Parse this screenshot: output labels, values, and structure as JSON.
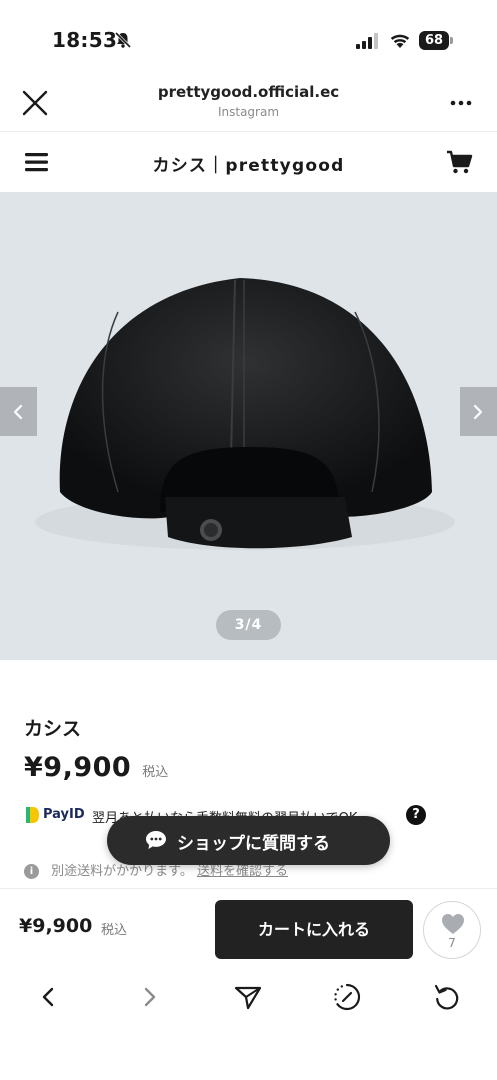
{
  "status_bar": {
    "time": "18:53",
    "battery": "68",
    "icons": [
      "bell-slash-icon",
      "signal-icon",
      "wifi-icon",
      "battery-icon"
    ]
  },
  "browser_header": {
    "domain": "prettygood.official.ec",
    "source": "Instagram",
    "icons": [
      "close-icon",
      "more-icon"
    ]
  },
  "shop_nav": {
    "title": "カシス｜prettygood",
    "icons": [
      "menu-icon",
      "cart-icon"
    ]
  },
  "carousel": {
    "page_indicator": "3/4",
    "current": 3,
    "total": 4,
    "icons": [
      "chevron-left-icon",
      "chevron-right-icon"
    ]
  },
  "product": {
    "name": "カシス",
    "price": "¥9,900",
    "tax_note": "税込",
    "payid_brand": "PayID",
    "payid_text": "翌月あと払いなら手数料無料の翌月払いでOK",
    "help_mark": "?",
    "info_mark": "i",
    "shipping_text": "別途送料がかかります。",
    "shipping_link": "送料を確認する"
  },
  "chat": {
    "label": "ショップに質問する",
    "icon": "chat-bubble-icon"
  },
  "buy_bar": {
    "price": "¥9,900",
    "tax_note": "税込",
    "add_to_cart": "カートに入れる",
    "like_count": "7",
    "icon": "heart-icon"
  },
  "toolbar": {
    "icons": [
      "back-icon",
      "forward-icon",
      "send-icon",
      "loading-icon",
      "refresh-icon"
    ]
  },
  "colors": {
    "primary_dark": "#222222",
    "image_background": "#dfe4e8",
    "payid_navy": "#1b2a5c"
  }
}
